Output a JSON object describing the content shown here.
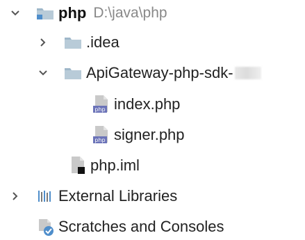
{
  "tree": {
    "root": {
      "name": "php",
      "path": "D:\\java\\php",
      "expanded": true
    },
    "items": [
      {
        "label": ".idea",
        "type": "folder",
        "expanded": false
      },
      {
        "label": "ApiGateway-php-sdk-",
        "type": "folder",
        "expanded": true,
        "children": [
          {
            "label": "index.php",
            "type": "php-file"
          },
          {
            "label": "signer.php",
            "type": "php-file"
          }
        ]
      },
      {
        "label": "php.iml",
        "type": "iml-file"
      }
    ],
    "external_libraries": {
      "label": "External Libraries",
      "expanded": false
    },
    "scratches": {
      "label": "Scratches and Consoles"
    }
  },
  "icons": {
    "chevron_down": "chevron-down-icon",
    "chevron_right": "chevron-right-icon",
    "folder": "folder-icon",
    "module_folder": "module-folder-icon",
    "php_file": "php-file-icon",
    "iml_file": "iml-file-icon",
    "libraries": "libraries-icon",
    "scratches": "scratches-icon"
  },
  "colors": {
    "folder": "#9eb7c9",
    "module_blue": "#4f8ecb",
    "php_purple": "#6b73b8",
    "path_gray": "#888888"
  }
}
